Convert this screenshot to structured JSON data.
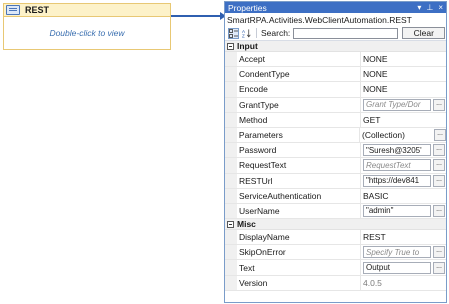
{
  "activity": {
    "title": "REST",
    "hint": "Double-click to view"
  },
  "panel": {
    "title": "Properties",
    "controls": [
      "▾",
      "⊥",
      "×"
    ],
    "subtitle": "SmartRPA.Activities.WebClientAutomation.REST",
    "search_label": "Search:",
    "search_value": "",
    "clear_label": "Clear"
  },
  "categories": [
    {
      "label": "Input",
      "rows": [
        {
          "name": "Accept",
          "value": "NONE",
          "kind": "plain"
        },
        {
          "name": "CondentType",
          "value": "NONE",
          "kind": "plain"
        },
        {
          "name": "Encode",
          "value": "NONE",
          "kind": "plain"
        },
        {
          "name": "GrantType",
          "value": "Grant Type/Dor",
          "kind": "placeholder"
        },
        {
          "name": "Method",
          "value": "GET",
          "kind": "plain"
        },
        {
          "name": "Parameters",
          "value": "(Collection)",
          "kind": "collection"
        },
        {
          "name": "Password",
          "value": "\"Suresh@3205'",
          "kind": "box"
        },
        {
          "name": "RequestText",
          "value": "RequestText",
          "kind": "placeholder"
        },
        {
          "name": "RESTUrl",
          "value": "\"https://dev841",
          "kind": "box"
        },
        {
          "name": "ServiceAuthentication",
          "value": "BASIC",
          "kind": "plain"
        },
        {
          "name": "UserName",
          "value": "\"admin\"",
          "kind": "box"
        }
      ]
    },
    {
      "label": "Misc",
      "rows": [
        {
          "name": "DisplayName",
          "value": "REST",
          "kind": "plain"
        },
        {
          "name": "SkipOnError",
          "value": "Specify True to",
          "kind": "placeholder"
        },
        {
          "name": "Text",
          "value": "Output",
          "kind": "box"
        },
        {
          "name": "Version",
          "value": "4.0.5",
          "kind": "gray"
        }
      ]
    }
  ]
}
